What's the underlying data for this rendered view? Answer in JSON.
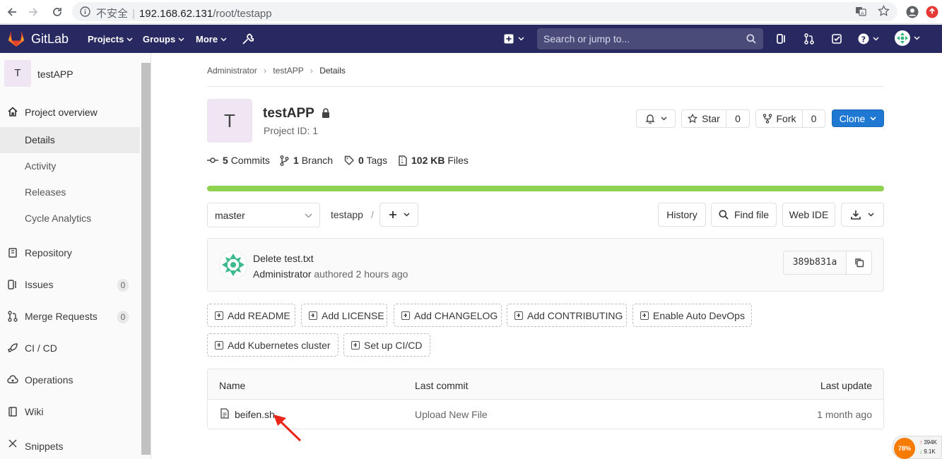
{
  "browser": {
    "security_label": "不安全",
    "separator": "|",
    "url_host": "192.168.62.131",
    "url_path": "/root/testapp"
  },
  "header": {
    "brand": "GitLab",
    "nav": [
      "Projects",
      "Groups",
      "More"
    ],
    "search_placeholder": "Search or jump to..."
  },
  "sidebar": {
    "project_initial": "T",
    "project_name": "testAPP",
    "overview": "Project overview",
    "sub_items": [
      "Details",
      "Activity",
      "Releases",
      "Cycle Analytics"
    ],
    "items": [
      {
        "label": "Repository"
      },
      {
        "label": "Issues",
        "count": "0"
      },
      {
        "label": "Merge Requests",
        "count": "0"
      },
      {
        "label": "CI / CD"
      },
      {
        "label": "Operations"
      },
      {
        "label": "Wiki"
      },
      {
        "label": "Snippets"
      }
    ]
  },
  "breadcrumb": [
    "Administrator",
    "testAPP",
    "Details"
  ],
  "project": {
    "initial": "T",
    "name": "testAPP",
    "id_label": "Project ID: 1",
    "star_label": "Star",
    "star_count": "0",
    "fork_label": "Fork",
    "fork_count": "0",
    "clone_label": "Clone"
  },
  "stats": {
    "commits_num": "5",
    "commits_label": "Commits",
    "branch_num": "1",
    "branch_label": "Branch",
    "tags_num": "0",
    "tags_label": "Tags",
    "files_num": "102 KB",
    "files_label": "Files"
  },
  "repo_bar": {
    "branch": "master",
    "path": "testapp",
    "slash": "/",
    "history": "History",
    "find_file": "Find file",
    "web_ide": "Web IDE"
  },
  "last_commit": {
    "title": "Delete test.txt",
    "author": "Administrator",
    "authored_text": "authored 2 hours ago",
    "sha": "389b831a"
  },
  "quick_actions": [
    "Add README",
    "Add LICENSE",
    "Add CHANGELOG",
    "Add CONTRIBUTING",
    "Enable Auto DevOps",
    "Add Kubernetes cluster",
    "Set up CI/CD"
  ],
  "file_table": {
    "columns": [
      "Name",
      "Last commit",
      "Last update"
    ],
    "rows": [
      {
        "name": "beifen.sh",
        "commit": "Upload New File",
        "updated": "1 month ago"
      }
    ]
  },
  "widget": {
    "percent": "78%",
    "up": "394K",
    "down": "9.1K"
  },
  "colors": {
    "header_bg": "#292961",
    "accent_blue": "#1f78d1",
    "progress_green": "#8fd14f",
    "avatar_bg": "#f0e5f3",
    "annotation_red": "#ea2418"
  }
}
